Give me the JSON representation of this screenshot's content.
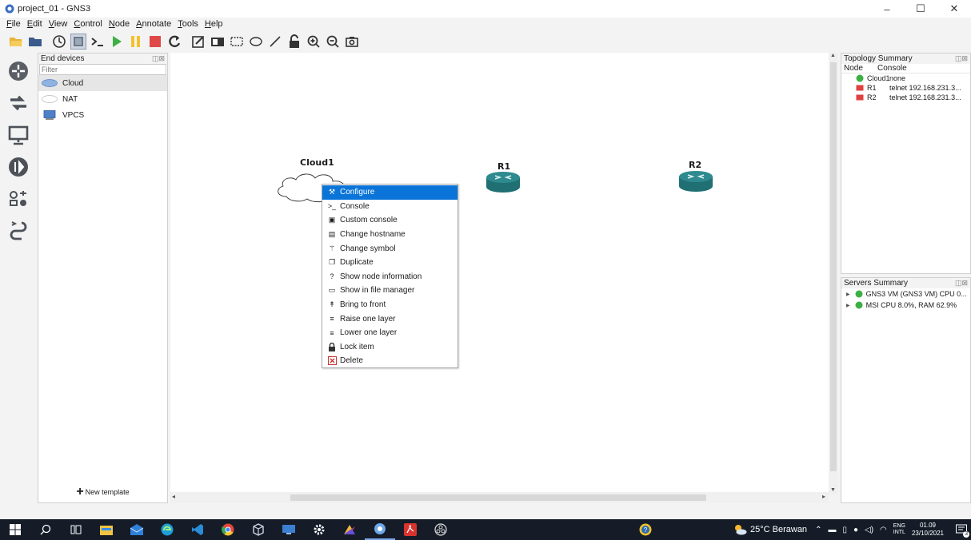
{
  "window": {
    "title": "project_01 - GNS3",
    "min": "–",
    "max": "☐",
    "close": "✕"
  },
  "menu": [
    "File",
    "Edit",
    "View",
    "Control",
    "Node",
    "Annotate",
    "Tools",
    "Help"
  ],
  "toolbar_icons": [
    "folder-open-icon",
    "folder-icon",
    "clock-icon",
    "snapshot-icon",
    "console-icon",
    "start-icon",
    "pause-icon",
    "stop-icon",
    "reload-icon",
    "note-icon",
    "image-icon",
    "rectangle-icon",
    "ellipse-icon",
    "line-icon",
    "lock-icon",
    "zoom-in-icon",
    "zoom-out-icon",
    "screenshot-icon"
  ],
  "device_panel": {
    "title": "End devices",
    "filter_placeholder": "Filter",
    "items": [
      "Cloud",
      "NAT",
      "VPCS"
    ],
    "new_template": "New template"
  },
  "canvas": {
    "nodes": [
      "Cloud1",
      "R1",
      "R2"
    ]
  },
  "context_menu": [
    {
      "label": "Configure",
      "icon": "wrench-icon"
    },
    {
      "label": "Console",
      "icon": "console-icon"
    },
    {
      "label": "Custom console",
      "icon": "custom-console-icon"
    },
    {
      "label": "Change hostname",
      "icon": "hostname-icon"
    },
    {
      "label": "Change symbol",
      "icon": "symbol-icon"
    },
    {
      "label": "Duplicate",
      "icon": "duplicate-icon"
    },
    {
      "label": "Show node information",
      "icon": "info-icon"
    },
    {
      "label": "Show in file manager",
      "icon": "folder-icon"
    },
    {
      "label": "Bring to front",
      "icon": "bring-front-icon"
    },
    {
      "label": "Raise one layer",
      "icon": "raise-icon"
    },
    {
      "label": "Lower one layer",
      "icon": "lower-icon"
    },
    {
      "label": "Lock item",
      "icon": "lock-icon"
    },
    {
      "label": "Delete",
      "icon": "delete-icon"
    }
  ],
  "topology_summary": {
    "title": "Topology Summary",
    "col_node": "Node",
    "col_console": "Console",
    "rows": [
      {
        "node": "Cloud1",
        "console": "none",
        "status": "green"
      },
      {
        "node": "R1",
        "console": "telnet 192.168.231.3...",
        "status": "red"
      },
      {
        "node": "R2",
        "console": "telnet 192.168.231.3...",
        "status": "red"
      }
    ]
  },
  "servers_summary": {
    "title": "Servers Summary",
    "rows": [
      "GNS3 VM (GNS3 VM) CPU 0...",
      "MSI CPU 8.0%, RAM 62.9%"
    ]
  },
  "taskbar": {
    "weather": "25°C Berawan",
    "lang1": "ENG",
    "lang2": "INTL",
    "time": "01.09",
    "date": "23/10/2021",
    "notifications": "3"
  },
  "colors": {
    "accent": "#0a74d8",
    "router": "#2d8a8f",
    "status_green": "#3cb043",
    "status_red": "#e04040"
  }
}
